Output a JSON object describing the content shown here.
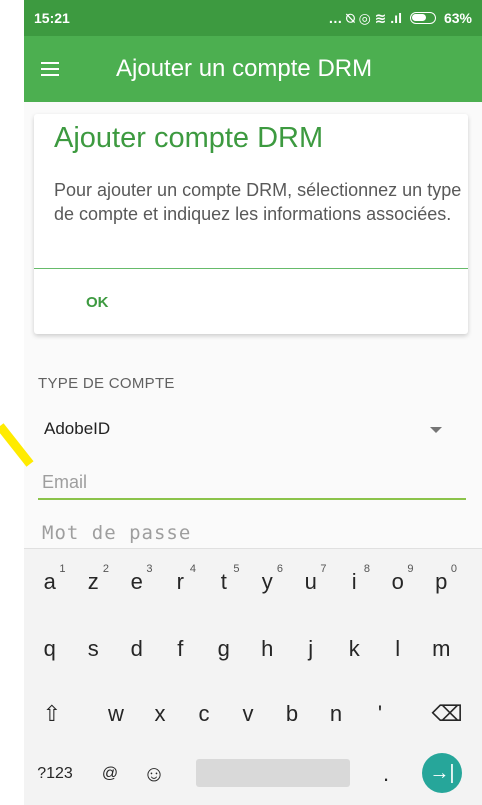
{
  "status_bar": {
    "time": "15:21",
    "signal_icons": "… ⍉ ◎ ≋ .ıl",
    "battery": "63%"
  },
  "app_bar": {
    "title": "Ajouter un compte DRM",
    "menu_icon": "hamburger-menu-icon"
  },
  "dialog": {
    "title": "Ajouter compte DRM",
    "message": "Pour ajouter un compte DRM, sélectionnez un type de compte et indiquez les informations associées.",
    "ok_label": "OK"
  },
  "form": {
    "account_type_label": "TYPE DE COMPTE",
    "account_type_value": "AdobeID",
    "email_placeholder": "Email",
    "password_placeholder": "Mot de passe"
  },
  "keyboard": {
    "row1": [
      {
        "k": "a",
        "h": "1"
      },
      {
        "k": "z",
        "h": "2"
      },
      {
        "k": "e",
        "h": "3"
      },
      {
        "k": "r",
        "h": "4"
      },
      {
        "k": "t",
        "h": "5"
      },
      {
        "k": "y",
        "h": "6"
      },
      {
        "k": "u",
        "h": "7"
      },
      {
        "k": "i",
        "h": "8"
      },
      {
        "k": "o",
        "h": "9"
      },
      {
        "k": "p",
        "h": "0"
      }
    ],
    "row2": [
      "q",
      "s",
      "d",
      "f",
      "g",
      "h",
      "j",
      "k",
      "l",
      "m"
    ],
    "row3": [
      "w",
      "x",
      "c",
      "v",
      "b",
      "n",
      "'"
    ],
    "shift": "⇧",
    "backspace": "⌫",
    "symbols": "?123",
    "at": "@",
    "emoji": "☺",
    "period": ".",
    "enter": "→|"
  },
  "colors": {
    "primary": "#4caf50",
    "primary_dark": "#3d9a40",
    "accent": "#26a69a",
    "annotation": "#ffeb00"
  }
}
